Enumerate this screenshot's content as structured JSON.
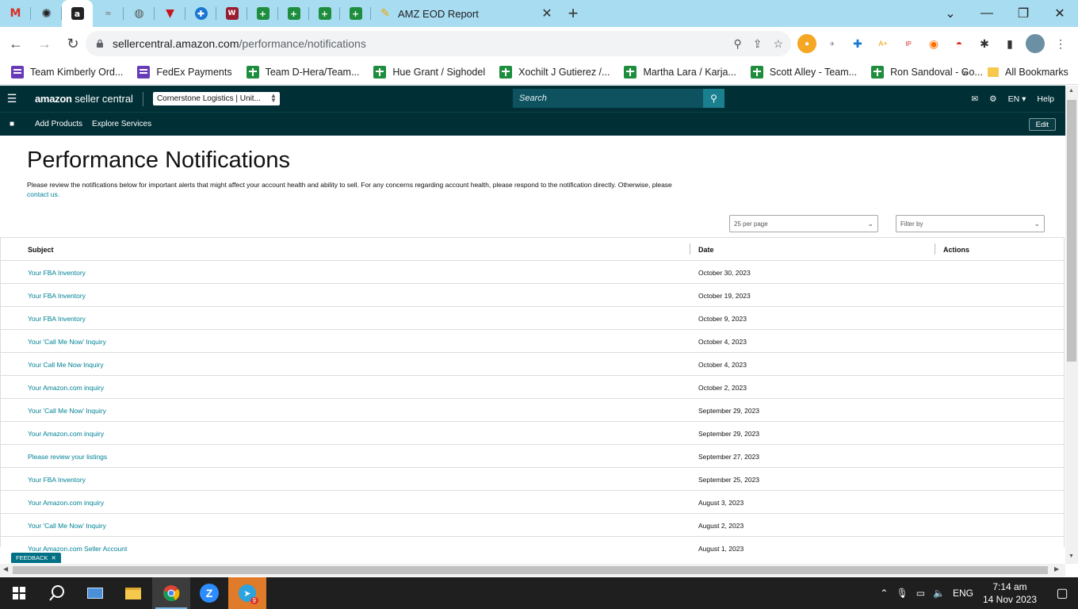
{
  "browser": {
    "active_tab_title": "AMZ EOD Report",
    "url_host": "sellercentral.amazon.com",
    "url_path": "/performance/notifications"
  },
  "bookmarks": [
    {
      "label": "Team Kimberly Ord...",
      "icon": "forms-icon"
    },
    {
      "label": "FedEx Payments",
      "icon": "forms-icon"
    },
    {
      "label": "Team D-Hera/Team...",
      "icon": "sheets-icon"
    },
    {
      "label": "Hue Grant / Sighodel",
      "icon": "sheets-icon"
    },
    {
      "label": "Xochilt J Gutierez /...",
      "icon": "sheets-icon"
    },
    {
      "label": "Martha Lara / Karja...",
      "icon": "sheets-icon"
    },
    {
      "label": "Scott Alley - Team...",
      "icon": "sheets-icon"
    },
    {
      "label": "Ron Sandoval - Go...",
      "icon": "sheets-icon"
    }
  ],
  "bookmarks_all": "All Bookmarks",
  "sc": {
    "logo_brand": "amazon",
    "logo_text": "seller central",
    "account": "Cornerstone Logistics | Unit...",
    "search_placeholder": "Search",
    "lang": "EN",
    "help": "Help",
    "subnav": [
      "Add Products",
      "Explore Services"
    ],
    "edit": "Edit"
  },
  "page": {
    "title": "Performance Notifications",
    "description": "Please review the notifications below for important alerts that might affect your account health and ability to sell. For any concerns regarding account health, please respond to the notification directly. Otherwise, please",
    "contact_link": "contact us.",
    "per_page": "25 per page",
    "filter": "Filter by"
  },
  "table": {
    "headers": {
      "subject": "Subject",
      "date": "Date",
      "actions": "Actions"
    },
    "rows": [
      {
        "subject": "Your FBA Inventory",
        "date": "October 30, 2023"
      },
      {
        "subject": "Your FBA Inventory",
        "date": "October 19, 2023"
      },
      {
        "subject": "Your FBA Inventory",
        "date": "October 9, 2023"
      },
      {
        "subject": "Your 'Call Me Now' Inquiry",
        "date": "October 4, 2023"
      },
      {
        "subject": "Your Call Me Now Inquiry",
        "date": "October 4, 2023"
      },
      {
        "subject": "Your Amazon.com inquiry",
        "date": "October 2, 2023"
      },
      {
        "subject": "Your 'Call Me Now' Inquiry",
        "date": "September 29, 2023"
      },
      {
        "subject": "Your Amazon.com inquiry",
        "date": "September 29, 2023"
      },
      {
        "subject": "Please review your listings",
        "date": "September 27, 2023"
      },
      {
        "subject": "Your FBA Inventory",
        "date": "September 25, 2023"
      },
      {
        "subject": "Your Amazon.com inquiry",
        "date": "August 3, 2023"
      },
      {
        "subject": "Your 'Call Me Now' Inquiry",
        "date": "August 2, 2023"
      },
      {
        "subject": "Your Amazon.com Seller Account",
        "date": "August 1, 2023"
      }
    ]
  },
  "feedback": "FEEDBACK",
  "taskbar": {
    "lang": "ENG",
    "time": "7:14 am",
    "date": "14 Nov 2023",
    "telegram_badge": "9"
  },
  "colors": {
    "sc_header": "#002f36",
    "link": "#008296",
    "tabstrip": "#a8dcf0"
  }
}
